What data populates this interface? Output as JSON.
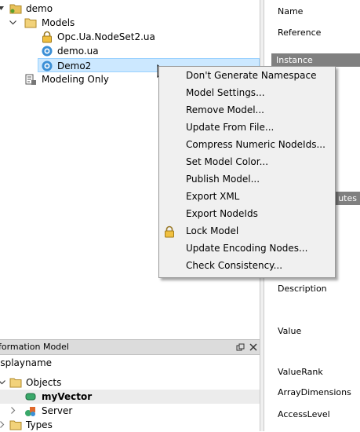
{
  "tree": {
    "root": "demo",
    "models": "Models",
    "items": [
      "Opc.Ua.NodeSet2.ua",
      "demo.ua",
      "Demo2"
    ],
    "modeling_only": "Modeling Only"
  },
  "context_menu": {
    "items": [
      "Don't Generate Namespace",
      "Model Settings...",
      "Remove Model...",
      "Update From File...",
      "Compress Numeric NodeIds...",
      "Set Model Color...",
      "Publish Model...",
      "Export XML",
      "Export NodeIds",
      "Lock Model",
      "Update Encoding Nodes...",
      "Check Consistency..."
    ]
  },
  "properties": {
    "name": "Name",
    "reference": "Reference",
    "section_instance": "Instance",
    "section_attributes": "utes",
    "description": "Description",
    "value": "Value",
    "value_rank": "ValueRank",
    "array_dimensions": "ArrayDimensions",
    "access_level": "AccessLevel"
  },
  "bottom_panel": {
    "title": "formation Model",
    "subheader": "isplayname",
    "objects": "Objects",
    "vector": "myVector",
    "server": "Server",
    "types": "Types"
  },
  "icons": {
    "folder": "folder-icon",
    "lock": "lock-icon",
    "model": "model-gear-icon",
    "modeling": "modeling-tool-icon",
    "server": "server-objects-icon",
    "vector": "variable-icon",
    "pin": "pin-icon",
    "close": "close-icon"
  },
  "colors": {
    "selection": "#cce8ff",
    "menu_bg": "#f0f0f0",
    "section_bg": "#808080",
    "folder": "#e8c15a"
  }
}
